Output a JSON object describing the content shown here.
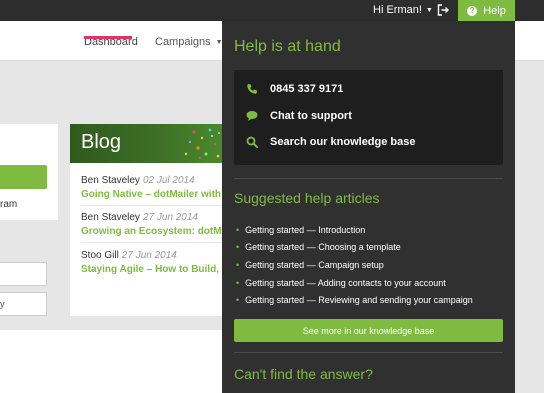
{
  "topbar": {
    "greeting": "Hi Erman!",
    "help_label": "Help",
    "logout_icon": "logout-icon"
  },
  "nav": {
    "dashboard": "Dashboard",
    "campaigns": "Campaigns"
  },
  "left_panel": {
    "partial_text": "ram",
    "input2_text": "y"
  },
  "blog": {
    "title": "Blog",
    "posts": [
      {
        "author": "Ben Staveley",
        "date": "02 Jul 2014",
        "title": "Going Native – dotMailer with"
      },
      {
        "author": "Ben Staveley",
        "date": "27 Jun 2014",
        "title": "Growing an Ecosystem: dotMai"
      },
      {
        "author": "Stoo Gill",
        "date": "27 Jun 2014",
        "title": "Staying Agile – How to Build, T"
      }
    ]
  },
  "help_panel": {
    "title": "Help is at hand",
    "contact": {
      "phone": "0845 337 9171",
      "chat": "Chat to support",
      "search": "Search our knowledge base"
    },
    "suggested_title": "Suggested help articles",
    "articles": [
      "Getting started — Introduction",
      "Getting started — Choosing a template",
      "Getting started — Campaign setup",
      "Getting started — Adding contacts to your account",
      "Getting started — Reviewing and sending your campaign"
    ],
    "more_button": "See more in our knowledge base",
    "cant_find": "Can't find the answer?"
  },
  "colors": {
    "accent": "#80bb41",
    "nav_underline": "#e0336a",
    "panel_bg": "#303030",
    "contact_box_bg": "#1e1e1e"
  }
}
